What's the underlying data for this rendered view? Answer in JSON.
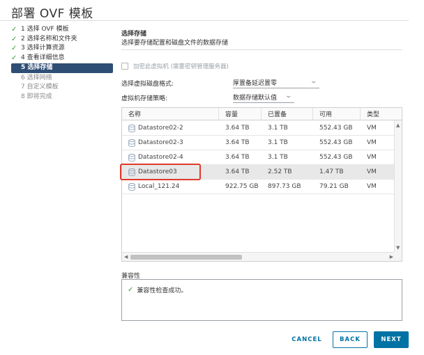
{
  "dialog": {
    "title": "部署 OVF 模板"
  },
  "steps": [
    {
      "label": "1 选择 OVF 模板",
      "state": "done"
    },
    {
      "label": "2 选择名称和文件夹",
      "state": "done"
    },
    {
      "label": "3 选择计算资源",
      "state": "done"
    },
    {
      "label": "4 查看详细信息",
      "state": "done"
    },
    {
      "label": "5 选择存储",
      "state": "active"
    },
    {
      "label": "6 选择网络",
      "state": "pending"
    },
    {
      "label": "7 自定义模板",
      "state": "pending"
    },
    {
      "label": "8 即将完成",
      "state": "pending"
    }
  ],
  "section": {
    "title": "选择存储",
    "description": "选择要存储配置和磁盘文件的数据存储"
  },
  "encrypt_checkbox": {
    "label": "加密此虚拟机 (需要密钥管理服务器)",
    "checked": false,
    "disabled": true
  },
  "disk_format": {
    "label": "选择虚拟磁盘格式:",
    "value": "厚置备延迟置零"
  },
  "storage_policy": {
    "label": "虚拟机存储策略:",
    "value": "数据存储默认值"
  },
  "table": {
    "columns": [
      "名称",
      "容量",
      "已置备",
      "可用",
      "类型"
    ],
    "rows": [
      {
        "name": "Datastore02-2",
        "capacity": "3.64 TB",
        "provisioned": "3.1 TB",
        "free": "552.43 GB",
        "type": "VM"
      },
      {
        "name": "Datastore02-3",
        "capacity": "3.64 TB",
        "provisioned": "3.1 TB",
        "free": "552.43 GB",
        "type": "VM"
      },
      {
        "name": "Datastore02-4",
        "capacity": "3.64 TB",
        "provisioned": "3.1 TB",
        "free": "552.43 GB",
        "type": "VM"
      },
      {
        "name": "Datastore03",
        "capacity": "3.64 TB",
        "provisioned": "2.52 TB",
        "free": "1.47 TB",
        "type": "VM"
      },
      {
        "name": "Local_121.24",
        "capacity": "922.75 GB",
        "provisioned": "897.73 GB",
        "free": "79.21 GB",
        "type": "VM"
      }
    ],
    "selected_index": 3
  },
  "compatibility": {
    "label": "兼容性",
    "message": "兼容性检查成功。"
  },
  "buttons": {
    "cancel": "CANCEL",
    "back": "BACK",
    "next": "NEXT"
  },
  "colors": {
    "accent": "#0072a3",
    "active_step": "#2f4e75",
    "success": "#3c9a3c",
    "highlight": "#e0392b"
  },
  "icons": {
    "step_done": "check-icon",
    "datastore": "datastore-icon",
    "compat_ok": "check-icon"
  }
}
